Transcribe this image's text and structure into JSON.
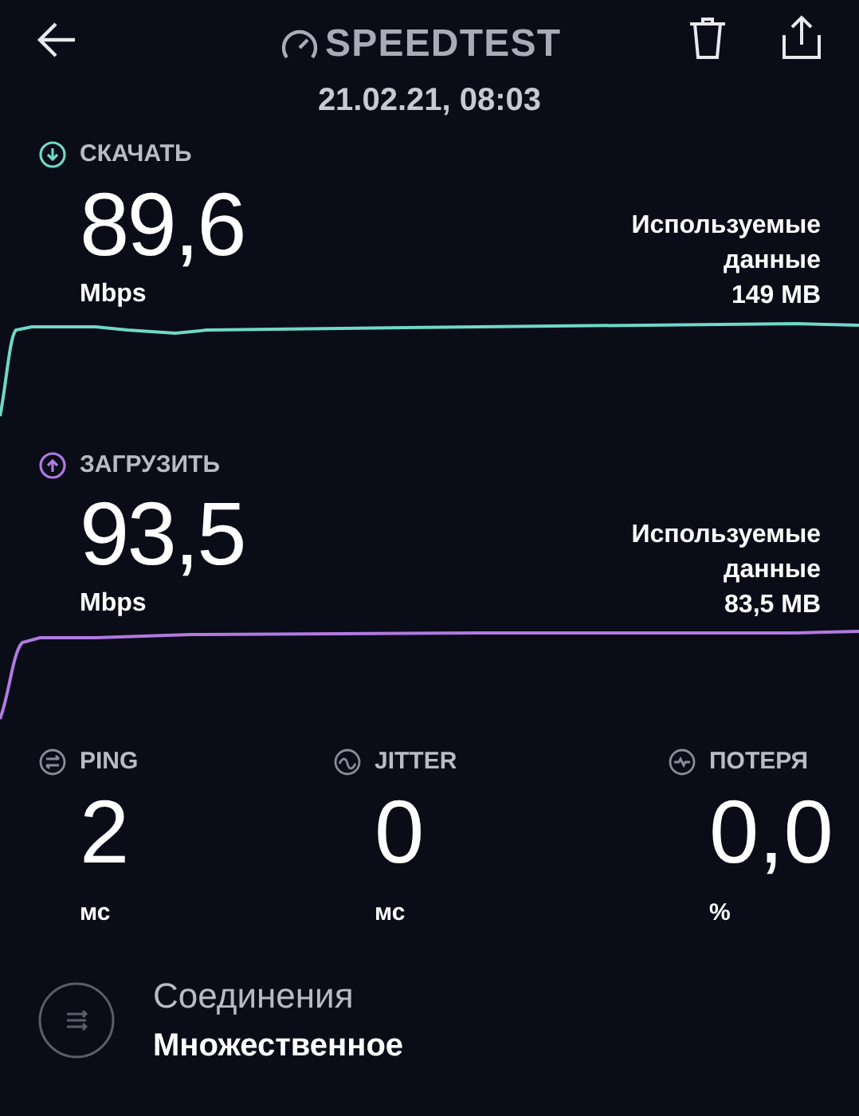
{
  "header": {
    "title": "SPEEDTEST",
    "date": "21.02.21, 08:03"
  },
  "sections": [
    {
      "kind": "download",
      "label": "СКАЧАТЬ",
      "value": "89,6",
      "unit": "Mbps",
      "data_label": "Используемые данные",
      "data_value": "149 MB",
      "color": "#6fd8c8"
    },
    {
      "kind": "upload",
      "label": "ЗАГРУЗИТЬ",
      "value": "93,5",
      "unit": "Mbps",
      "data_label": "Используемые данные",
      "data_value": "83,5 MB",
      "color": "#b07ae0"
    }
  ],
  "stats": [
    {
      "kind": "ping",
      "label": "PING",
      "value": "2",
      "unit": "мс"
    },
    {
      "kind": "jitter",
      "label": "JITTER",
      "value": "0",
      "unit": "мс"
    },
    {
      "kind": "loss",
      "label": "ПОТЕРЯ",
      "value": "0,0",
      "unit": "%"
    }
  ],
  "connections": {
    "title": "Соединения",
    "value": "Множественное"
  }
}
